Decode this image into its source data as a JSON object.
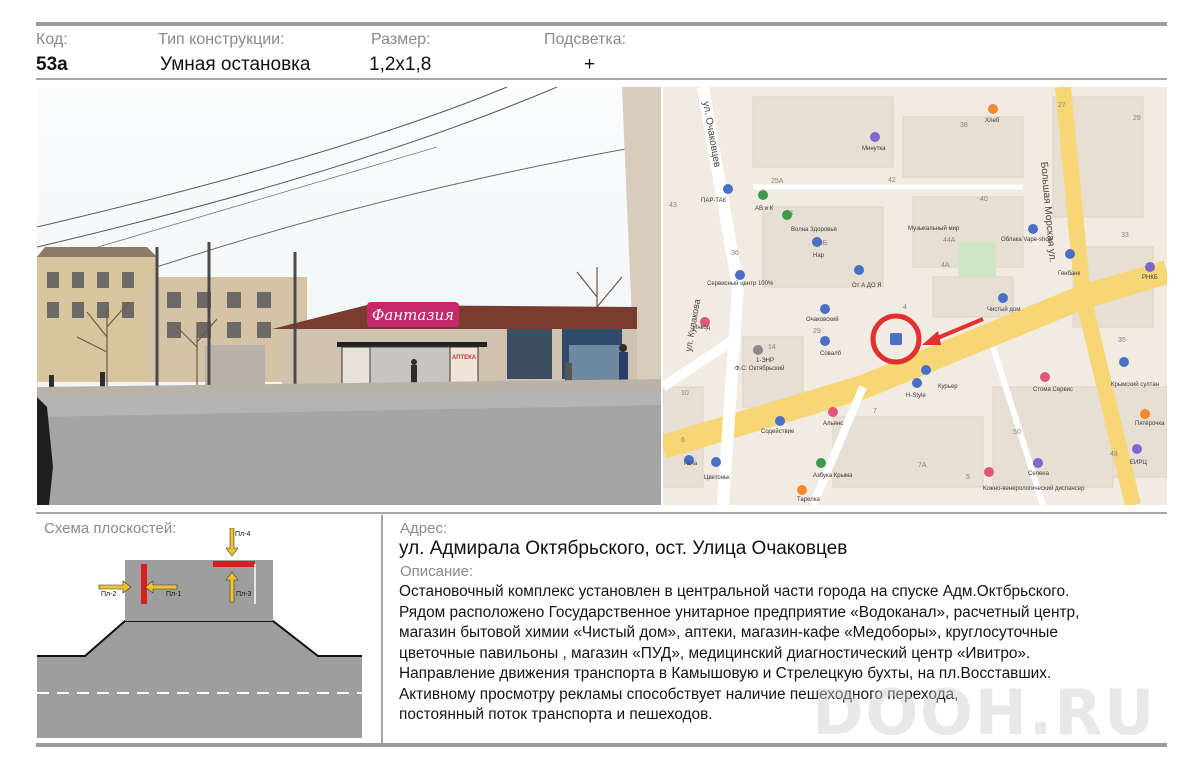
{
  "header": {
    "code_label": "Код:",
    "code_value": "53а",
    "type_label": "Тип конструкции:",
    "type_value": "Умная остановка",
    "size_label": "Размер:",
    "size_value": "1,2х1,8",
    "light_label": "Подсветка:",
    "light_value": "+"
  },
  "photo": {
    "store_sign": "Фантазия",
    "pharmacy_sign": "АПТЕКА"
  },
  "map": {
    "streets": [
      "ул. Очаковцев",
      "Большая Морская ул.",
      "ул. Кулакова"
    ],
    "buildings": [
      "27",
      "29",
      "38",
      "42",
      "40",
      "33",
      "25А",
      "31",
      "29Б",
      "36",
      "4А",
      "44А",
      "4",
      "14",
      "35",
      "29",
      "2",
      "7",
      "7А",
      "5",
      "50",
      "48",
      "43",
      "10",
      "6"
    ],
    "places": [
      "Хлеб",
      "Минутка",
      "ПАР-ТАК",
      "АВ и К",
      "Волна Здоровья",
      "Нар",
      "Музыкальный мир",
      "Облака Vape-shop",
      "Генбанк",
      "РНКБ",
      "Сервисный центр 100%",
      "От А ДО Я",
      "Очаковский",
      "Чистый дом",
      "Инкод",
      "1-ЭНР",
      "Ф.С. Октябрьский",
      "Совалб",
      "Курьер",
      "H-Style",
      "Стома Сервис",
      "Крымский султан",
      "Пятёрочка",
      "Альянс",
      "Содействие",
      "Гала",
      "Цветоньк",
      "Азбука Крыма",
      "Тарелка",
      "Кожно-венерологический диспансер",
      "Селена",
      "ЕИРЦ"
    ],
    "colors": {
      "bg": "#f1ebe1",
      "road": "#f6d675",
      "marker": "#e03030"
    }
  },
  "scheme": {
    "title": "Схема плоскостей:",
    "planes": [
      "Пл-4",
      "Пл-2",
      "Пл-1",
      "Пл-3"
    ]
  },
  "address": {
    "label": "Адрес:",
    "value": "ул. Адмирала Октябрьского, ост. Улица Очаковцев"
  },
  "description": {
    "label": "Описание:",
    "lines": [
      "Остановочный комплекс установлен в центральной части города  на спуске Адм.Октбрьского.",
      "Рядом расположено Государственное унитарное предприятие «Водоканал», расчетный центр,",
      "магазин бытовой химии «Чистый дом», аптеки, магазин-кафе «Медоборы»,  круглосуточные",
      "цветочные павильоны , магазин «ПУД»,  медицинский диагностический центр «Ивитро».",
      "Направление движения транспорта в Камышовую и Стрелецкую бухты, на пл.Восставших.",
      "Активному просмотру рекламы способствует наличие пешеходного перехода,",
      "постоянный  поток транспорта и пешеходов."
    ]
  },
  "watermark": "DOOH.RU"
}
